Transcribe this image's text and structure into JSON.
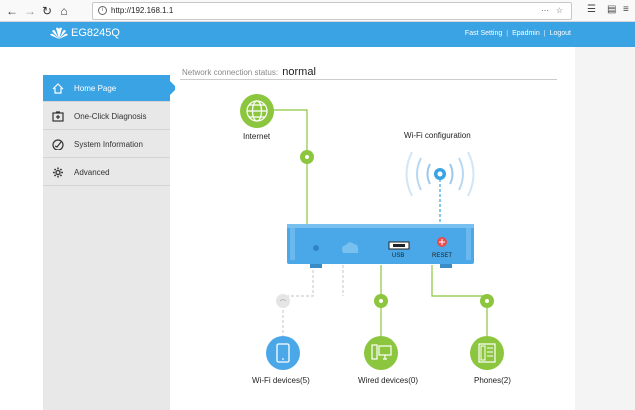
{
  "browser": {
    "url": "http://192.168.1.1",
    "back_icon": "arrow-left-icon",
    "forward_icon": "arrow-right-icon",
    "reload_icon": "reload-icon",
    "home_icon": "home-icon"
  },
  "header": {
    "brand_color": "#3aa3e3",
    "model": "EG8245Q",
    "links": [
      "Fast Setting",
      "Epadmin",
      "Logout"
    ]
  },
  "sidebar": {
    "items": [
      {
        "label": "Home Page",
        "icon": "home-icon",
        "active": true
      },
      {
        "label": "One-Click Diagnosis",
        "icon": "first-aid-icon",
        "active": false
      },
      {
        "label": "System Information",
        "icon": "gauge-icon",
        "active": false
      },
      {
        "label": "Advanced",
        "icon": "gear-icon",
        "active": false
      }
    ]
  },
  "main": {
    "status_label": "Network connection status:",
    "status_value": "normal",
    "internet_label": "Internet",
    "wifi_config_label": "Wi-Fi configuration",
    "usb_label": "USB",
    "reset_label": "RESET",
    "wifi_devices_label": "Wi-Fi devices(5)",
    "wired_devices_label": "Wired devices(0)",
    "phones_label": "Phones(2)"
  },
  "colors": {
    "accent": "#3aa3e3",
    "green": "#8cc63f",
    "device_blue": "#4aa8e8",
    "reset_red": "#e84c4c"
  }
}
